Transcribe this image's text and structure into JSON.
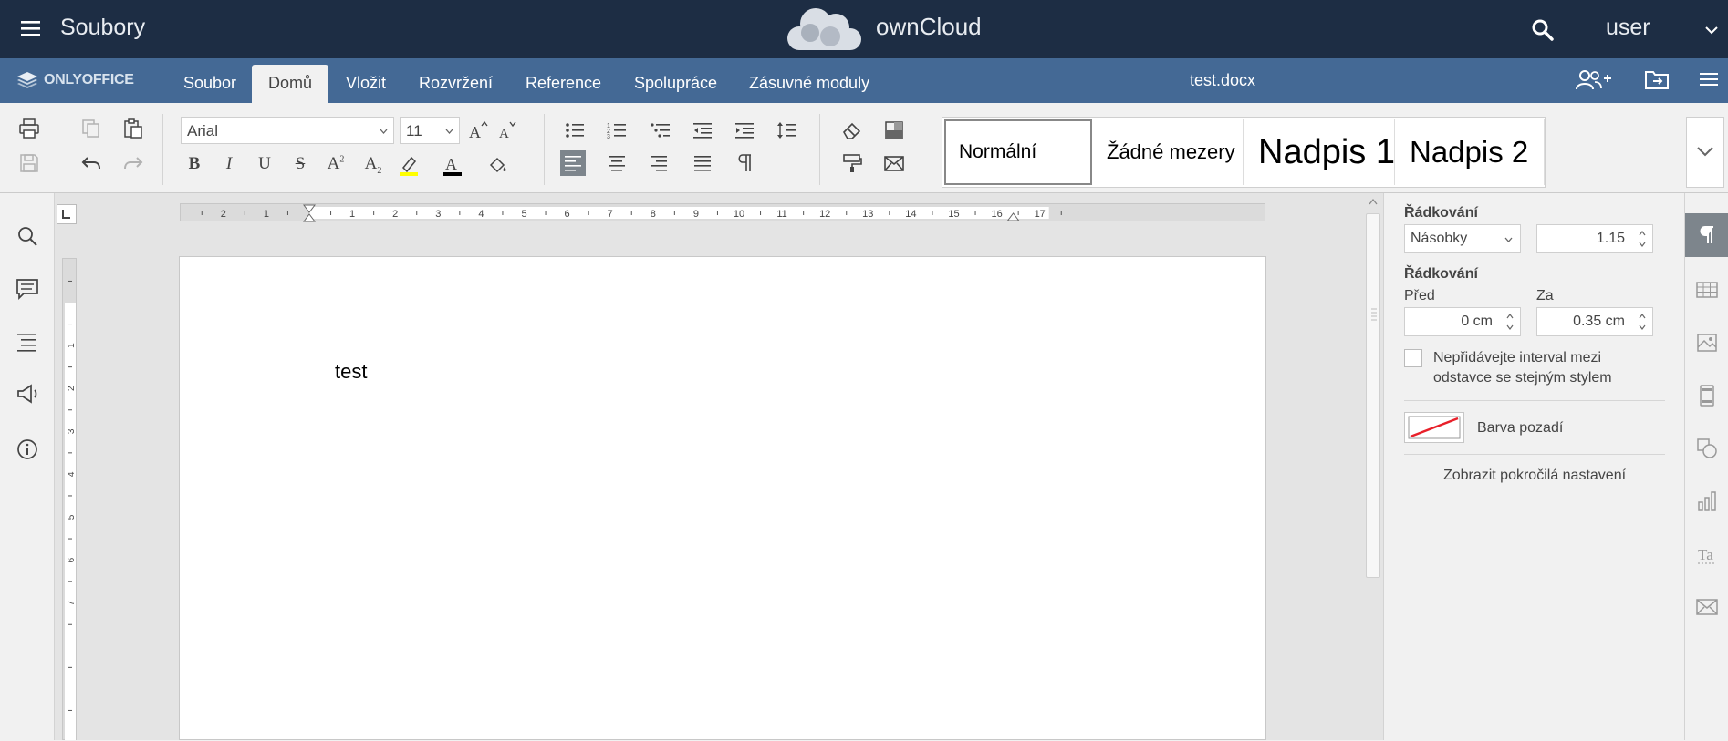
{
  "owncloud": {
    "app_name": "Soubory",
    "brand": "ownCloud",
    "user": "user",
    "icons": [
      "menu-icon",
      "owncloud-logo",
      "search-icon",
      "caret-down-icon"
    ],
    "bar_color": "#1d2d44"
  },
  "onlyoffice": {
    "logo_text": "ONLYOFFICE",
    "bar_color": "#446995",
    "tabs": [
      {
        "label": "Soubor",
        "active": false
      },
      {
        "label": "Domů",
        "active": true
      },
      {
        "label": "Vložit",
        "active": false
      },
      {
        "label": "Rozvržení",
        "active": false
      },
      {
        "label": "Reference",
        "active": false
      },
      {
        "label": "Spolupráce",
        "active": false
      },
      {
        "label": "Zásuvné moduly",
        "active": false
      }
    ],
    "document_title": "test.docx",
    "header_icons": [
      "add-user-icon",
      "open-file-location-icon",
      "hamburger-menu-icon"
    ]
  },
  "toolbar": {
    "font_name": "Arial",
    "font_size": "11",
    "bold": "B",
    "italic": "I",
    "underline": "U",
    "strike": "S",
    "superscript": "A",
    "superscript_mark": "2",
    "subscript": "A",
    "subscript_mark": "2",
    "highlight_color": "#ffff00",
    "font_color": "#000000",
    "align_active": "left",
    "styles": [
      {
        "label": "Normální"
      },
      {
        "label": "Žádné mezery"
      },
      {
        "label": "Nadpis 1"
      },
      {
        "label": "Nadpis 2"
      }
    ]
  },
  "document": {
    "text": "test"
  },
  "ruler": {
    "h_left": [
      "2",
      "1"
    ],
    "h_right": [
      "1",
      "2",
      "3",
      "4",
      "5",
      "6",
      "7",
      "8",
      "9",
      "10",
      "11",
      "12",
      "13",
      "14",
      "15",
      "16",
      "17"
    ],
    "v_marks": [
      "1",
      "2",
      "3",
      "4",
      "5",
      "6",
      "7"
    ]
  },
  "paragraph_panel": {
    "line_spacing_label": "Řádkování",
    "line_spacing_mode": "Násobky",
    "line_spacing_value": "1.15",
    "spacing_label": "Řádkování",
    "before_label": "Před",
    "before_value": "0 cm",
    "after_label": "Za",
    "after_value": "0.35 cm",
    "checkbox_label_1": "Nepřidávejte interval mezi",
    "checkbox_label_2": "odstavce se stejným stylem",
    "checkbox_checked": false,
    "bg_color_label": "Barva pozadí",
    "advanced_link": "Zobrazit pokročilá nastavení"
  },
  "right_tabs": [
    "paragraph-icon",
    "table-icon",
    "image-icon",
    "header-footer-icon",
    "shape-icon",
    "chart-icon",
    "text-art-icon",
    "mail-merge-icon"
  ],
  "left_sidebar": [
    "search-icon",
    "comments-icon",
    "navigation-icon",
    "feedback-icon",
    "about-icon"
  ],
  "accent_arrow_color": "#f15a24"
}
